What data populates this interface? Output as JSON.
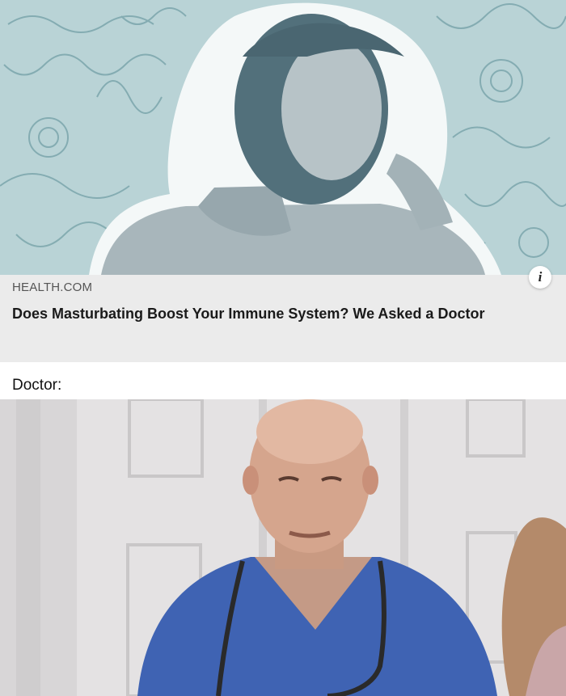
{
  "article": {
    "source": "HEALTH.COM",
    "headline": "Does Masturbating Boost Your Immune System? We Asked a Doctor",
    "info_icon": "i"
  },
  "meme": {
    "caption": "Doctor:"
  },
  "colors": {
    "hero_bg": "#b9d3d6",
    "card_bg": "#ebebeb",
    "scrubs": "#3f63b3"
  }
}
